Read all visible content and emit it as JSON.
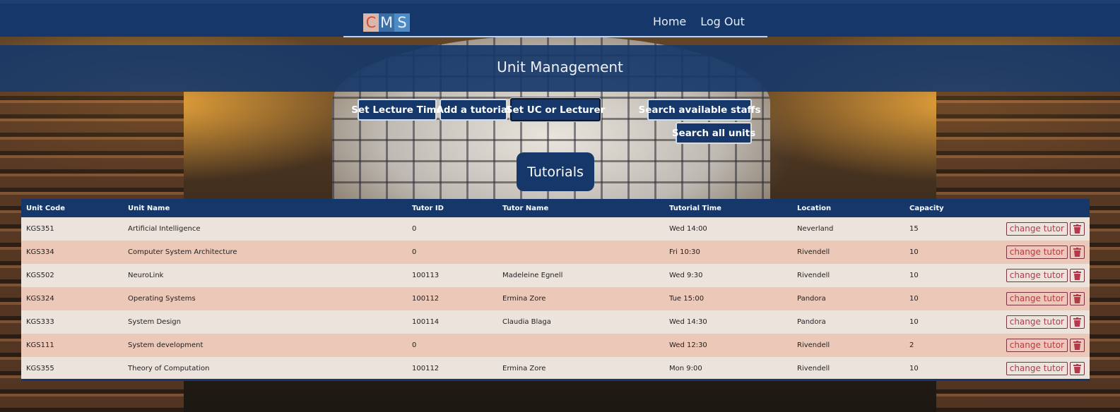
{
  "app": {
    "logo": [
      "C",
      "M",
      "S"
    ]
  },
  "nav": {
    "home": "Home",
    "logout": "Log Out"
  },
  "banner": {
    "title": "Unit Management"
  },
  "actions": {
    "set_lecture_time": "Set Lecture Time",
    "add_tutorial": "Add a tutorial",
    "set_uc": "Set UC or Lecturer",
    "search_staffs": "Search available staffs",
    "search_units": "Search all units"
  },
  "section": {
    "title": "Tutorials"
  },
  "table": {
    "headers": [
      "Unit Code",
      "Unit Name",
      "Tutor ID",
      "Tutor Name",
      "Tutorial Time",
      "Location",
      "Capacity"
    ],
    "change_label": "change tutor",
    "rows": [
      {
        "code": "KGS351",
        "name": "Artificial Intelligence",
        "tutor_id": "0",
        "tutor_name": "",
        "time": "Wed 14:00",
        "location": "Neverland",
        "capacity": "15"
      },
      {
        "code": "KGS334",
        "name": "Computer System Architecture",
        "tutor_id": "0",
        "tutor_name": "",
        "time": "Fri 10:30",
        "location": "Rivendell",
        "capacity": "10"
      },
      {
        "code": "KGS502",
        "name": "NeuroLink",
        "tutor_id": "100113",
        "tutor_name": "Madeleine Egnell",
        "time": "Wed 9:30",
        "location": "Rivendell",
        "capacity": "10"
      },
      {
        "code": "KGS324",
        "name": "Operating Systems",
        "tutor_id": "100112",
        "tutor_name": "Ermina Zore",
        "time": "Tue 15:00",
        "location": "Pandora",
        "capacity": "10"
      },
      {
        "code": "KGS333",
        "name": "System Design",
        "tutor_id": "100114",
        "tutor_name": "Claudia Blaga",
        "time": "Wed 14:30",
        "location": "Pandora",
        "capacity": "10"
      },
      {
        "code": "KGS111",
        "name": "System development",
        "tutor_id": "0",
        "tutor_name": "",
        "time": "Wed 12:30",
        "location": "Rivendell",
        "capacity": "2"
      },
      {
        "code": "KGS355",
        "name": "Theory of Computation",
        "tutor_id": "100112",
        "tutor_name": "Ermina Zore",
        "time": "Mon 9:00",
        "location": "Rivendell",
        "capacity": "10"
      }
    ]
  },
  "colors": {
    "navy": "#163769",
    "row_light": "#ede3dd",
    "row_dark": "#ecc8b8",
    "danger": "#b5394c"
  }
}
